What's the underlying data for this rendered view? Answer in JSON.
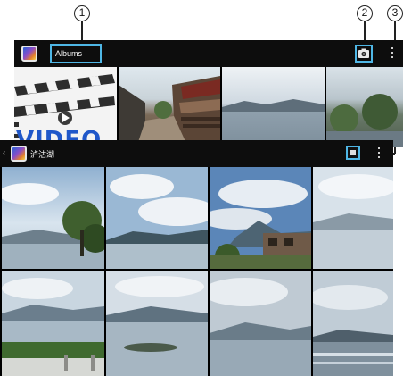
{
  "callouts": [
    "1",
    "2",
    "3"
  ],
  "albums_view": {
    "title": "Albums",
    "camera_icon": "camera-icon",
    "overflow_icon": "more-vert-icon",
    "video_label": "VIDEO"
  },
  "album_view": {
    "title": "泸沽湖",
    "back_icon": "chevron-left-icon",
    "back_glyph": "‹",
    "slideshow_icon": "slideshow-icon",
    "overflow_icon": "more-vert-icon"
  },
  "colors": {
    "highlight": "#4fb7e6",
    "bar": "#0d0d0d"
  }
}
